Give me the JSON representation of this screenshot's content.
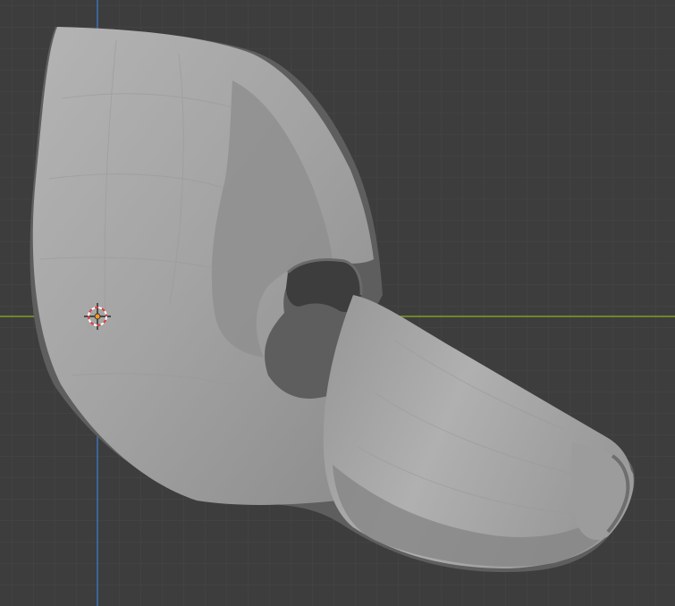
{
  "viewport": {
    "name": "3d-viewport",
    "background_color": "#3d3d3d",
    "grid": {
      "visible": true,
      "minor_color": "#474747",
      "major_color": "#4d4d4d"
    },
    "axes": {
      "x_axis_color": "#8ab31f",
      "y_axis_color": "#3b7fd6"
    },
    "object": {
      "name": "mask-mesh",
      "shading": "solid",
      "base_color": "#a8a8a8"
    },
    "cursor": {
      "name": "3d-cursor",
      "ring_colors": [
        "#ffffff",
        "#e23b3b"
      ],
      "origin_color": "#f29a1f"
    }
  }
}
